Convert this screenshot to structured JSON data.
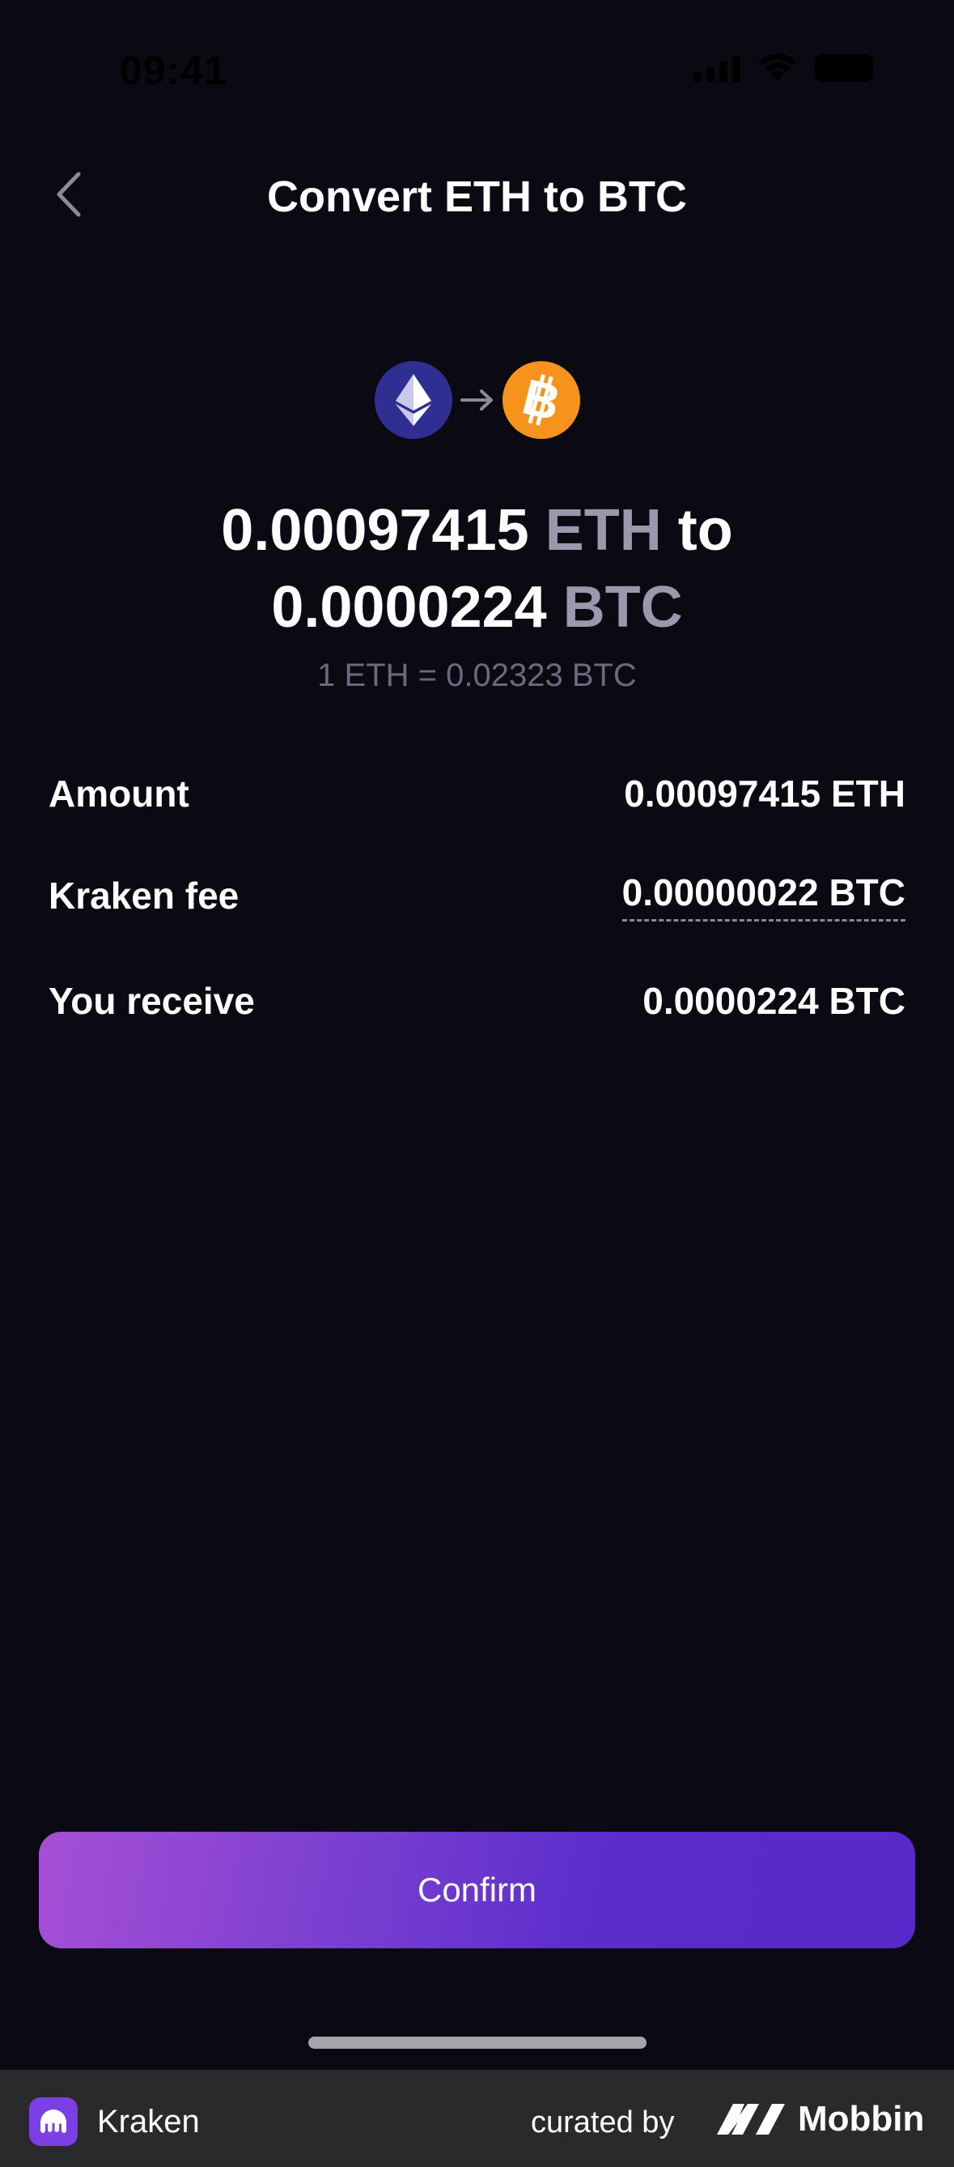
{
  "status_bar": {
    "time": "09:41"
  },
  "header": {
    "title": "Convert ETH to BTC"
  },
  "conversion": {
    "from_amount": "0.00097415",
    "from_unit": "ETH",
    "connector": "to",
    "to_amount": "0.0000224",
    "to_unit": "BTC",
    "rate": "1 ETH = 0.02323 BTC"
  },
  "details": [
    {
      "label": "Amount",
      "value": "0.00097415 ETH"
    },
    {
      "label": "Kraken fee",
      "value": "0.00000022 BTC"
    },
    {
      "label": "You receive",
      "value": "0.0000224 BTC"
    }
  ],
  "confirm_label": "Confirm",
  "footer": {
    "app_name": "Kraken",
    "curated_by": "curated by",
    "brand": "Mobbin"
  },
  "colors": {
    "background": "#0b0a13",
    "accent_start": "#a64fd6",
    "accent_end": "#5729c9",
    "eth": "#2f2f92",
    "btc": "#f7931a",
    "muted_text": "#9c97ad"
  },
  "icons": [
    "back-chevron-icon",
    "ethereum-icon",
    "arrow-right-icon",
    "bitcoin-icon",
    "kraken-logo-icon",
    "mobbin-logo-icon"
  ]
}
